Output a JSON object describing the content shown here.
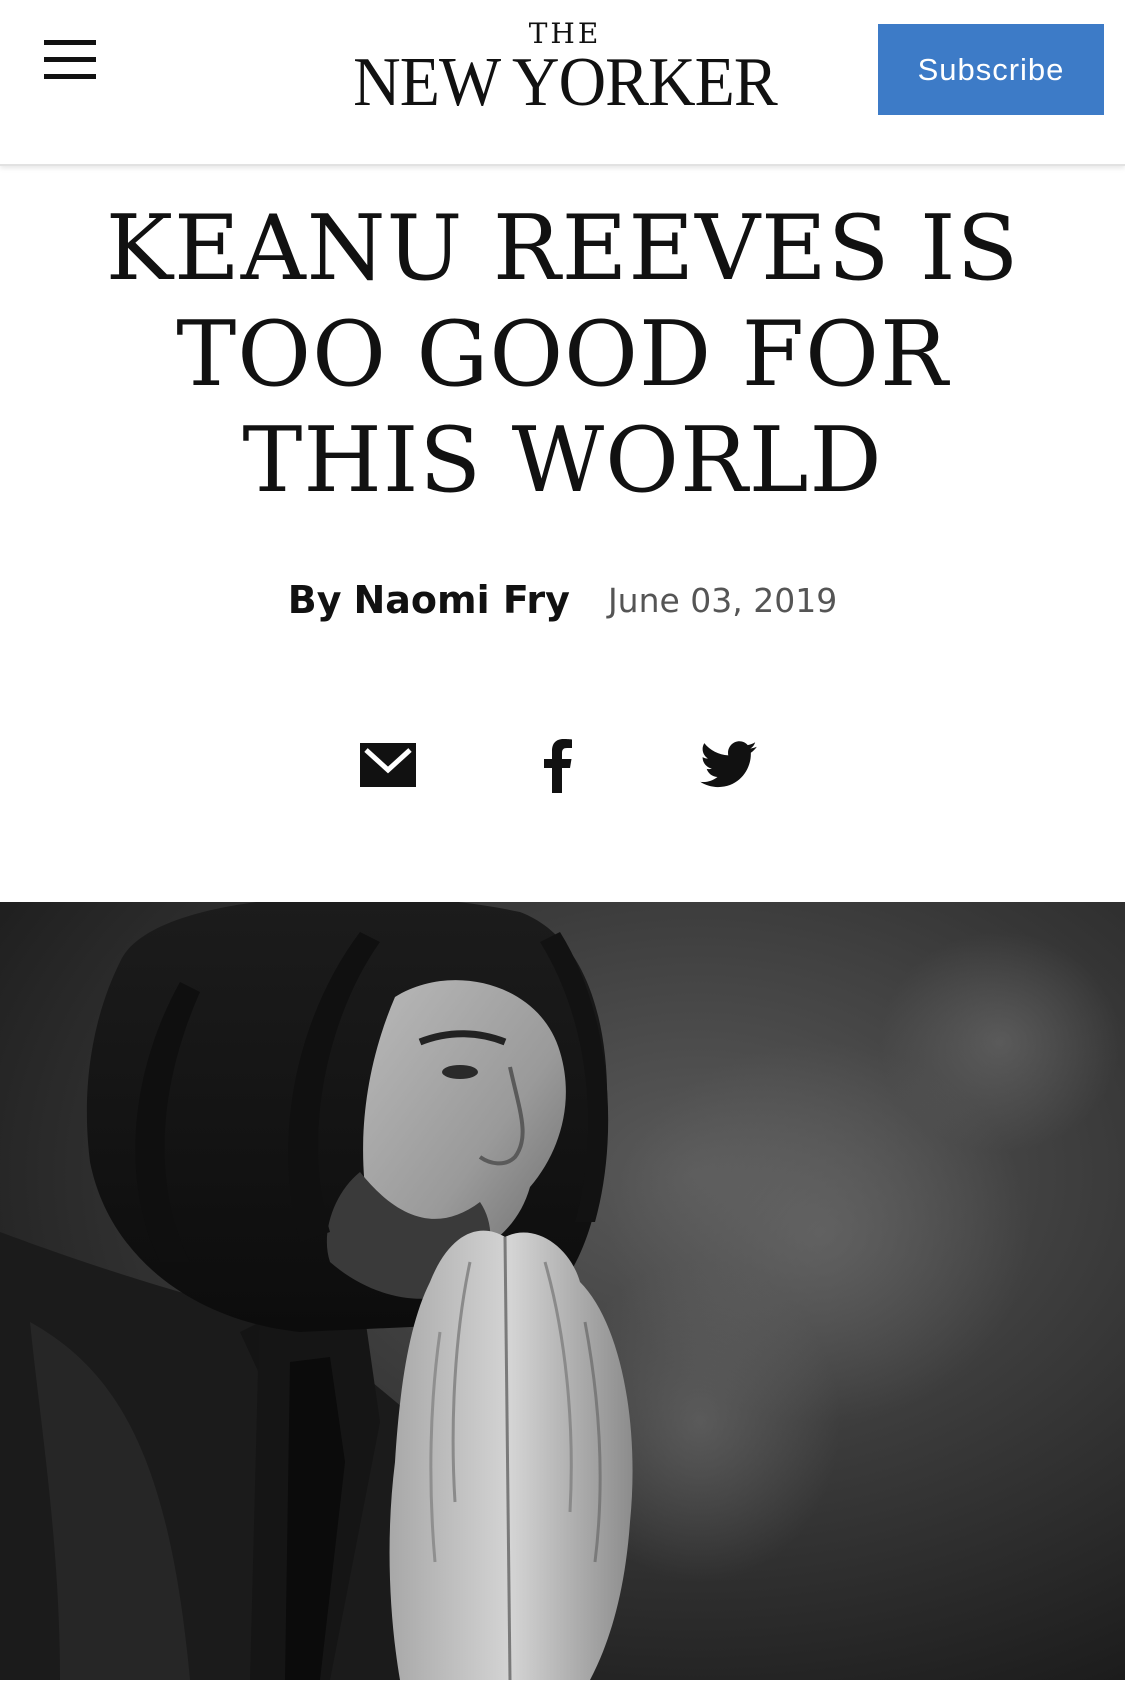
{
  "header": {
    "menu_icon": "hamburger-menu-icon",
    "logo_the": "THE",
    "logo_name": "NEW YORKER",
    "subscribe_label": "Subscribe",
    "subscribe_color": "#3d7bc7"
  },
  "article": {
    "title_lines": [
      "KEANU REEVES IS",
      "TOO GOOD FOR",
      "THIS WORLD"
    ],
    "byline_prefix": "By",
    "author": "Naomi Fry",
    "date": "June 03, 2019"
  },
  "share": {
    "icons": [
      "email-icon",
      "facebook-icon",
      "twitter-icon"
    ]
  },
  "hero_image": {
    "subject": "black-and-white portrait of long-haired bearded man with hands pressed together"
  }
}
